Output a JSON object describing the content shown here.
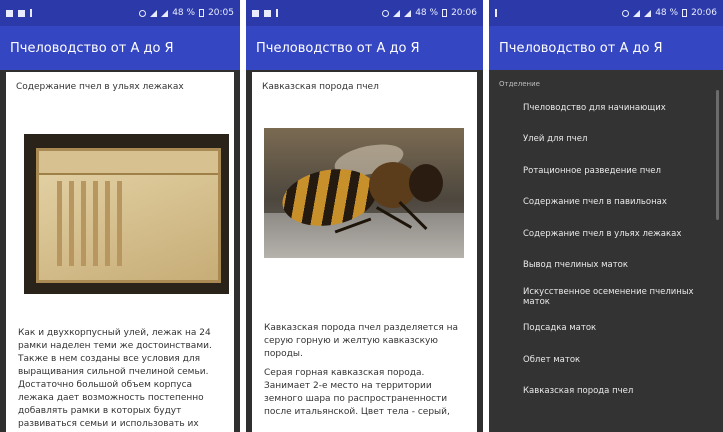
{
  "status": {
    "time": "20:05",
    "time2": "20:06",
    "battery": "48 %"
  },
  "app": {
    "title": "Пчеловодство от А до Я"
  },
  "panel1": {
    "heading": "Содержание пчел в ульях лежаках",
    "paragraphs": [
      "Как и двухкорпусный улей, лежак на 24 рамки наделен теми же достоинствами. Также в нем созданы все условия для выращивания сильной пчелиной семьи. Достаточно большой объем корпуса лежака дает возможность постепенно добавлять рамки в которых будут развиваться семьи и использовать их"
    ]
  },
  "panel2": {
    "heading": "Кавказская порода пчел",
    "paragraphs": [
      "Кавказская порода пчел разделяется на серую горную и желтую кавказскую породы.",
      "Серая горная кавказская порода. Занимает 2-е место на территории земного шара по распространенности после итальянской. Цвет тела - серый,"
    ]
  },
  "panel3": {
    "section_header": "Отделение",
    "menu_items": [
      "Пчеловодство для начинающих",
      "Улей для пчел",
      "Ротационное разведение пчел",
      "Содержание пчел в павильонах",
      "Содержание пчел в ульях лежаках",
      "Вывод пчелиных маток",
      "Искусственное осеменение пчелиных маток",
      "Подсадка маток",
      "Облет маток",
      "Кавказская порода пчел"
    ]
  },
  "colors": {
    "statusbar": "#2b3aa8",
    "appbar": "#3546c2",
    "drawer": "#333333"
  }
}
